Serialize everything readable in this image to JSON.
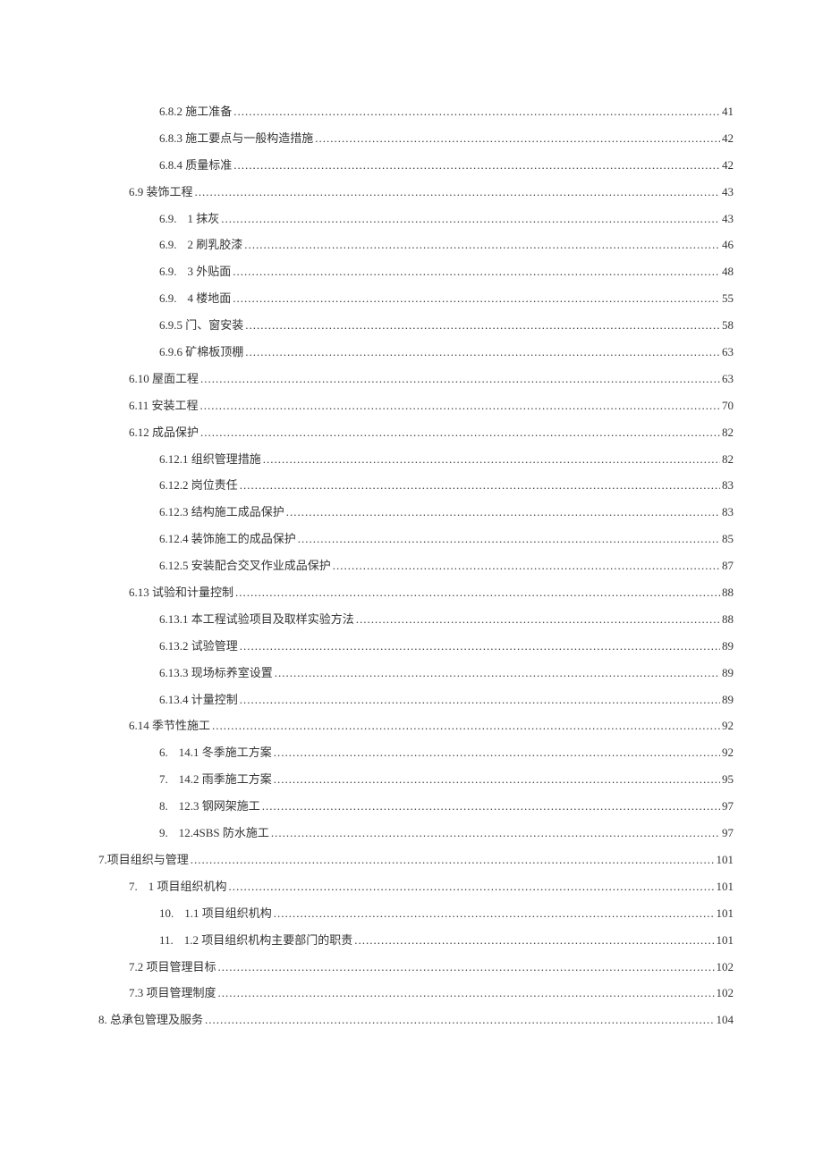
{
  "toc": [
    {
      "indent": 2,
      "label": "6.8.2 施工准备",
      "page": "41"
    },
    {
      "indent": 2,
      "label": "6.8.3 施工要点与一般构造措施",
      "page": "42"
    },
    {
      "indent": 2,
      "label": "6.8.4 质量标准",
      "page": "42"
    },
    {
      "indent": 1,
      "label": "6.9 装饰工程",
      "page": "43"
    },
    {
      "indent": 2,
      "prefix": "6.9.",
      "label": "1 抹灰",
      "page": "43"
    },
    {
      "indent": 2,
      "prefix": "6.9.",
      "label": "2 刷乳胶漆",
      "page": "46"
    },
    {
      "indent": 2,
      "prefix": "6.9.",
      "label": "3 外贴面",
      "page": "48"
    },
    {
      "indent": 2,
      "prefix": "6.9.",
      "label": "4 楼地面",
      "page": "55"
    },
    {
      "indent": 2,
      "label": "6.9.5 门、窗安装",
      "page": "58"
    },
    {
      "indent": 2,
      "label": "6.9.6 矿棉板顶棚",
      "page": "63"
    },
    {
      "indent": 1,
      "label": "6.10 屋面工程",
      "page": "63"
    },
    {
      "indent": 1,
      "label": "6.11 安装工程",
      "page": "70"
    },
    {
      "indent": 1,
      "label": "6.12 成品保护",
      "page": "82"
    },
    {
      "indent": 2,
      "label": "6.12.1 组织管理措施",
      "page": "82"
    },
    {
      "indent": 2,
      "label": "6.12.2 岗位责任",
      "page": "83"
    },
    {
      "indent": 2,
      "label": "6.12.3 结构施工成品保护",
      "page": "83"
    },
    {
      "indent": 2,
      "label": "6.12.4 装饰施工的成品保护",
      "page": "85"
    },
    {
      "indent": 2,
      "label": "6.12.5 安装配合交叉作业成品保护",
      "page": "87"
    },
    {
      "indent": 1,
      "label": "6.13 试验和计量控制",
      "page": "88"
    },
    {
      "indent": 2,
      "label": "6.13.1 本工程试验项目及取样实验方法",
      "page": "88"
    },
    {
      "indent": 2,
      "label": "6.13.2 试验管理",
      "page": "89"
    },
    {
      "indent": 2,
      "label": "6.13.3 现场标养室设置",
      "page": "89"
    },
    {
      "indent": 2,
      "label": "6.13.4 计量控制",
      "page": "89"
    },
    {
      "indent": 1,
      "label": "6.14 季节性施工",
      "page": "92"
    },
    {
      "indent": 2,
      "prefix": "6.",
      "label": "14.1 冬季施工方案",
      "page": "92"
    },
    {
      "indent": 2,
      "prefix": "7.",
      "label": "14.2 雨季施工方案",
      "page": "95"
    },
    {
      "indent": 2,
      "prefix": "8.",
      "label": "12.3 钢网架施工",
      "page": "97"
    },
    {
      "indent": 2,
      "prefix": "9.",
      "label": "12.4SBS 防水施工",
      "page": "97"
    },
    {
      "indent": 0,
      "label": "7.项目组织与管理",
      "page": "101"
    },
    {
      "indent": 1,
      "prefix": "7.",
      "label": "1 项目组织机构",
      "page": "101"
    },
    {
      "indent": 2,
      "prefix": "10.",
      "label": "1.1 项目组织机构",
      "page": "101"
    },
    {
      "indent": 2,
      "prefix": "11.",
      "label": "1.2 项目组织机构主要部门的职责",
      "page": "101"
    },
    {
      "indent": 1,
      "label": "7.2 项目管理目标",
      "page": "102"
    },
    {
      "indent": 1,
      "label": "7.3 项目管理制度",
      "page": "102"
    },
    {
      "indent": 0,
      "label": "8. 总承包管理及服务",
      "page": "104"
    }
  ]
}
